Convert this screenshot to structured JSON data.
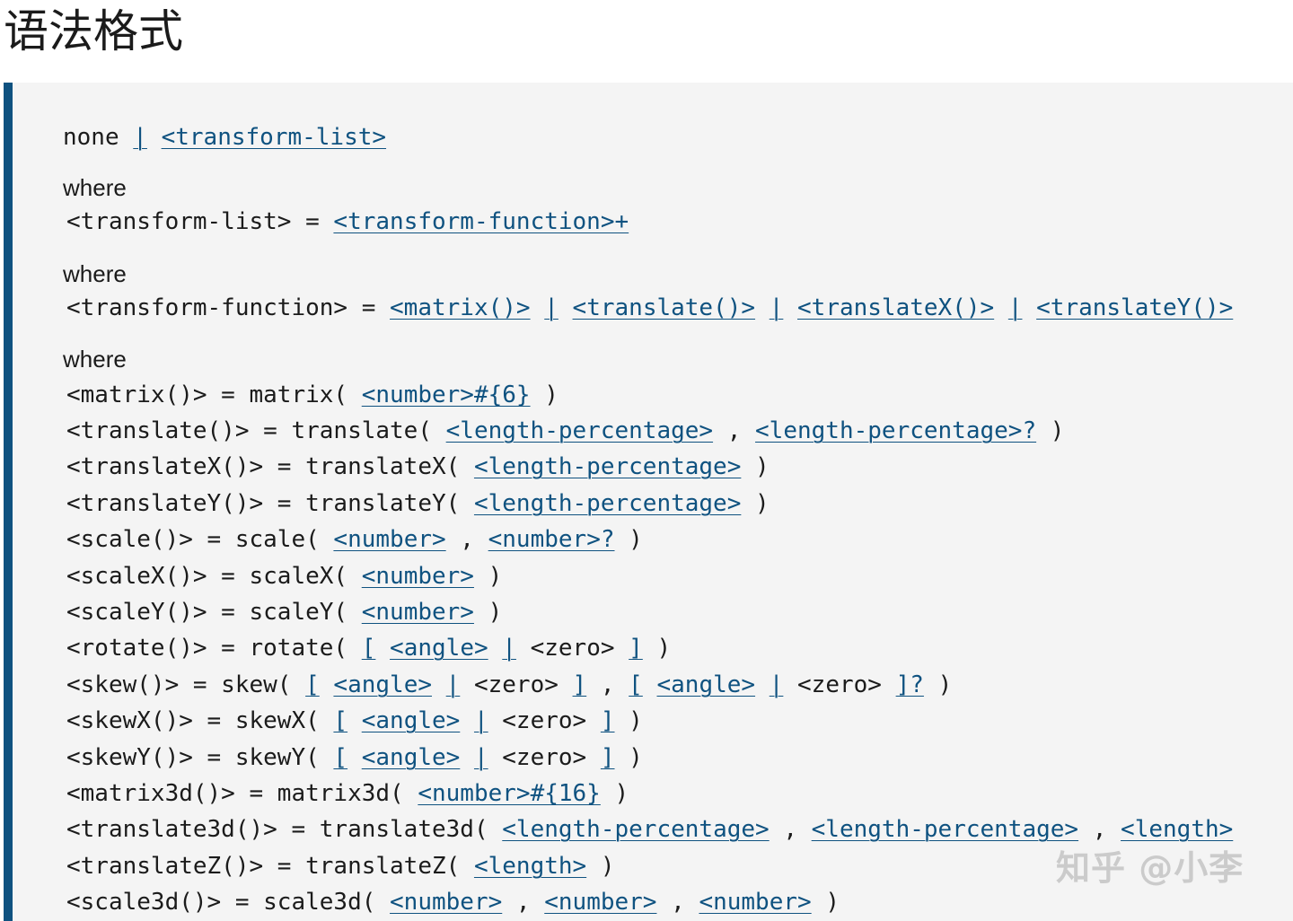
{
  "heading": "语法格式",
  "lines": [
    {
      "kind": "value",
      "parts": [
        {
          "t": "none "
        },
        {
          "t": "|",
          "link": true
        },
        {
          "t": " "
        },
        {
          "t": "<transform-list>",
          "link": true
        }
      ]
    },
    {
      "kind": "where",
      "text": "where"
    },
    {
      "kind": "def",
      "parts": [
        {
          "t": "<transform-list> = "
        },
        {
          "t": "<transform-function>+",
          "link": true
        }
      ]
    },
    {
      "kind": "where",
      "text": "where"
    },
    {
      "kind": "def",
      "parts": [
        {
          "t": "<transform-function> = "
        },
        {
          "t": "<matrix()>",
          "link": true
        },
        {
          "t": " "
        },
        {
          "t": "|",
          "link": true
        },
        {
          "t": " "
        },
        {
          "t": "<translate()>",
          "link": true
        },
        {
          "t": " "
        },
        {
          "t": "|",
          "link": true
        },
        {
          "t": " "
        },
        {
          "t": "<translateX()>",
          "link": true
        },
        {
          "t": " "
        },
        {
          "t": "|",
          "link": true
        },
        {
          "t": " "
        },
        {
          "t": "<translateY()>",
          "link": true
        }
      ]
    },
    {
      "kind": "where",
      "text": "where"
    },
    {
      "kind": "def",
      "parts": [
        {
          "t": "<matrix()> = matrix( "
        },
        {
          "t": "<number>#{6}",
          "link": true
        },
        {
          "t": " )"
        }
      ]
    },
    {
      "kind": "def",
      "parts": [
        {
          "t": "<translate()> = translate( "
        },
        {
          "t": "<length-percentage>",
          "link": true
        },
        {
          "t": " , "
        },
        {
          "t": "<length-percentage>?",
          "link": true
        },
        {
          "t": " )"
        }
      ]
    },
    {
      "kind": "def",
      "parts": [
        {
          "t": "<translateX()> = translateX( "
        },
        {
          "t": "<length-percentage>",
          "link": true
        },
        {
          "t": " )"
        }
      ]
    },
    {
      "kind": "def",
      "parts": [
        {
          "t": "<translateY()> = translateY( "
        },
        {
          "t": "<length-percentage>",
          "link": true
        },
        {
          "t": " )"
        }
      ]
    },
    {
      "kind": "def",
      "parts": [
        {
          "t": "<scale()> = scale( "
        },
        {
          "t": "<number>",
          "link": true
        },
        {
          "t": " , "
        },
        {
          "t": "<number>?",
          "link": true
        },
        {
          "t": " )"
        }
      ]
    },
    {
      "kind": "def",
      "parts": [
        {
          "t": "<scaleX()> = scaleX( "
        },
        {
          "t": "<number>",
          "link": true
        },
        {
          "t": " )"
        }
      ]
    },
    {
      "kind": "def",
      "parts": [
        {
          "t": "<scaleY()> = scaleY( "
        },
        {
          "t": "<number>",
          "link": true
        },
        {
          "t": " )"
        }
      ]
    },
    {
      "kind": "def",
      "parts": [
        {
          "t": "<rotate()> = rotate( "
        },
        {
          "t": "[",
          "link": true
        },
        {
          "t": " "
        },
        {
          "t": "<angle>",
          "link": true
        },
        {
          "t": " "
        },
        {
          "t": "|",
          "link": true
        },
        {
          "t": " <zero> "
        },
        {
          "t": "]",
          "link": true
        },
        {
          "t": " )"
        }
      ]
    },
    {
      "kind": "def",
      "parts": [
        {
          "t": "<skew()> = skew( "
        },
        {
          "t": "[",
          "link": true
        },
        {
          "t": " "
        },
        {
          "t": "<angle>",
          "link": true
        },
        {
          "t": " "
        },
        {
          "t": "|",
          "link": true
        },
        {
          "t": " <zero> "
        },
        {
          "t": "]",
          "link": true
        },
        {
          "t": " , "
        },
        {
          "t": "[",
          "link": true
        },
        {
          "t": " "
        },
        {
          "t": "<angle>",
          "link": true
        },
        {
          "t": " "
        },
        {
          "t": "|",
          "link": true
        },
        {
          "t": " <zero> "
        },
        {
          "t": "]?",
          "link": true
        },
        {
          "t": " )"
        }
      ]
    },
    {
      "kind": "def",
      "parts": [
        {
          "t": "<skewX()> = skewX( "
        },
        {
          "t": "[",
          "link": true
        },
        {
          "t": " "
        },
        {
          "t": "<angle>",
          "link": true
        },
        {
          "t": " "
        },
        {
          "t": "|",
          "link": true
        },
        {
          "t": " <zero> "
        },
        {
          "t": "]",
          "link": true
        },
        {
          "t": " )"
        }
      ]
    },
    {
      "kind": "def",
      "parts": [
        {
          "t": "<skewY()> = skewY( "
        },
        {
          "t": "[",
          "link": true
        },
        {
          "t": " "
        },
        {
          "t": "<angle>",
          "link": true
        },
        {
          "t": " "
        },
        {
          "t": "|",
          "link": true
        },
        {
          "t": " <zero> "
        },
        {
          "t": "]",
          "link": true
        },
        {
          "t": " )"
        }
      ]
    },
    {
      "kind": "def",
      "parts": [
        {
          "t": "<matrix3d()> = matrix3d( "
        },
        {
          "t": "<number>#{16}",
          "link": true
        },
        {
          "t": " )"
        }
      ]
    },
    {
      "kind": "def",
      "parts": [
        {
          "t": "<translate3d()> = translate3d( "
        },
        {
          "t": "<length-percentage>",
          "link": true
        },
        {
          "t": " , "
        },
        {
          "t": "<length-percentage>",
          "link": true
        },
        {
          "t": " , "
        },
        {
          "t": "<length>",
          "link": true
        }
      ]
    },
    {
      "kind": "def",
      "parts": [
        {
          "t": "<translateZ()> = translateZ( "
        },
        {
          "t": "<length>",
          "link": true
        },
        {
          "t": " )"
        }
      ]
    },
    {
      "kind": "def",
      "parts": [
        {
          "t": "<scale3d()> = scale3d( "
        },
        {
          "t": "<number>",
          "link": true
        },
        {
          "t": " , "
        },
        {
          "t": "<number>",
          "link": true
        },
        {
          "t": " , "
        },
        {
          "t": "<number>",
          "link": true
        },
        {
          "t": " )"
        }
      ]
    }
  ],
  "watermark": "知乎 @小李",
  "colors": {
    "link": "#0f5280",
    "accent_bar": "#0f5280",
    "box_bg": "#f4f4f4",
    "text": "#1b1b1b"
  }
}
